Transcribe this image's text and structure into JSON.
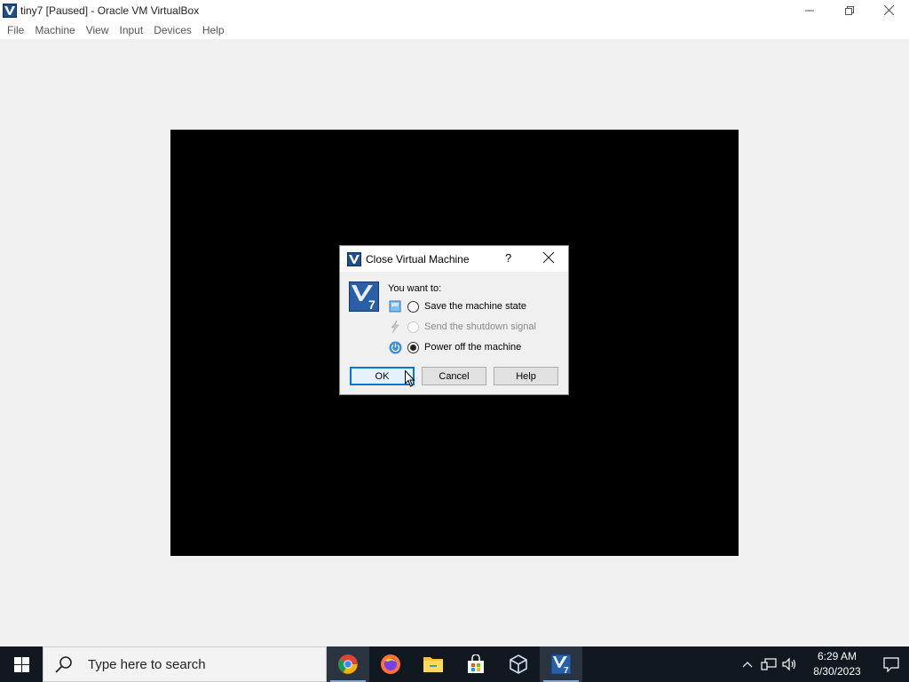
{
  "window": {
    "title": "tiny7 [Paused] - Oracle VM VirtualBox",
    "app_icon": "virtualbox-icon",
    "controls": {
      "minimize": "minimize-icon",
      "restore": "restore-icon",
      "close": "close-icon"
    }
  },
  "menu": {
    "items": [
      {
        "label": "File"
      },
      {
        "label": "Machine"
      },
      {
        "label": "View"
      },
      {
        "label": "Input"
      },
      {
        "label": "Devices"
      },
      {
        "label": "Help"
      }
    ]
  },
  "dialog": {
    "title": "Close Virtual Machine",
    "help_mark": "?",
    "prompt": "You want to:",
    "options": [
      {
        "label": "Save the machine state",
        "selected": false,
        "enabled": true,
        "icon": "save-state-icon"
      },
      {
        "label": "Send the shutdown signal",
        "selected": false,
        "enabled": false,
        "icon": "shutdown-signal-icon"
      },
      {
        "label": "Power off the machine",
        "selected": true,
        "enabled": true,
        "icon": "power-off-icon"
      }
    ],
    "buttons": {
      "ok": "OK",
      "cancel": "Cancel",
      "help": "Help"
    }
  },
  "taskbar": {
    "search_placeholder": "Type here to search",
    "apps": [
      {
        "name": "chrome-icon",
        "active": true
      },
      {
        "name": "firefox-icon",
        "active": false
      },
      {
        "name": "file-explorer-icon",
        "active": false
      },
      {
        "name": "microsoft-store-icon",
        "active": false
      },
      {
        "name": "virtualbox-manager-icon",
        "active": false
      },
      {
        "name": "virtualbox-vm-icon",
        "active": true
      }
    ],
    "clock": {
      "time": "6:29 AM",
      "date": "8/30/2023"
    }
  },
  "colors": {
    "accent": "#0078d7",
    "taskbar": "#101820",
    "vm_screen": "#000000"
  }
}
